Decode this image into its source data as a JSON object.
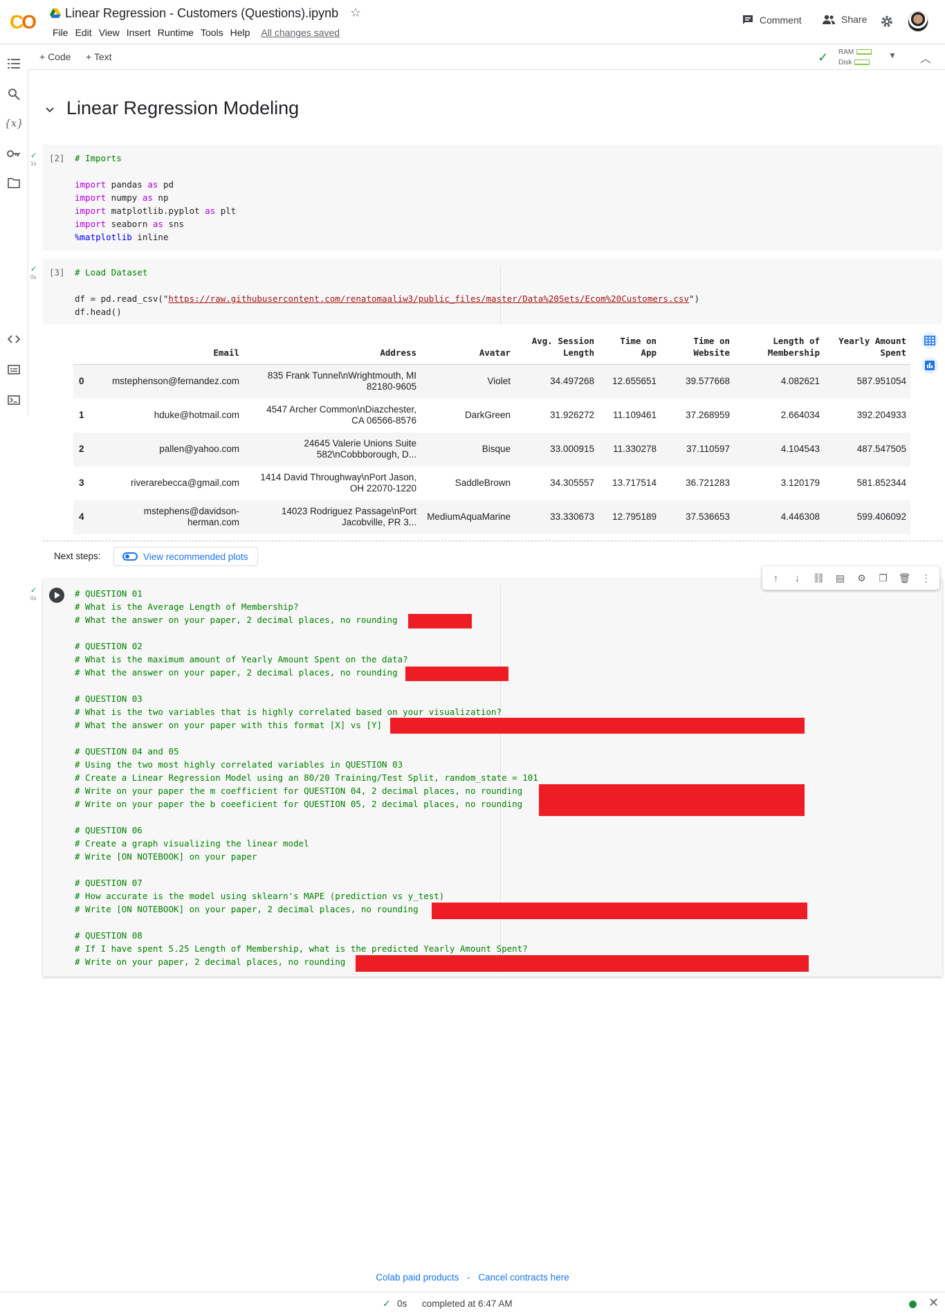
{
  "app": {
    "logo": "CO",
    "title": "Linear Regression - Customers (Questions).ipynb",
    "menu": [
      "File",
      "Edit",
      "View",
      "Insert",
      "Runtime",
      "Tools",
      "Help"
    ],
    "save_status": "All changes saved",
    "comment_label": "Comment",
    "share_label": "Share"
  },
  "toolbar": {
    "add_code": "+ Code",
    "add_text": "+ Text",
    "ram_label": "RAM",
    "disk_label": "Disk"
  },
  "section": {
    "title": "Linear Regression Modeling"
  },
  "cell_imports": {
    "exec_count": "[2]",
    "time": "1s",
    "lines": {
      "comment": "# Imports",
      "l1_kw": "import",
      "l1_rest": " pandas ",
      "l1_as": "as",
      "l1_alias": " pd",
      "l2_kw": "import",
      "l2_rest": " numpy ",
      "l2_as": "as",
      "l2_alias": " np",
      "l3_kw": "import",
      "l3_rest": " matplotlib.pyplot ",
      "l3_as": "as",
      "l3_alias": " plt",
      "l4_kw": "import",
      "l4_rest": " seaborn ",
      "l4_as": "as",
      "l4_alias": " sns",
      "l5_magic": "%matplotlib",
      "l5_rest": " inline"
    }
  },
  "cell_load": {
    "exec_count": "[3]",
    "time": "0s",
    "comment": "# Load Dataset",
    "read_prefix": "df = pd.read_csv(\"",
    "url": "https://raw.githubusercontent.com/renatomaaliw3/public_files/master/Data%20Sets/Ecom%20Customers.csv",
    "read_suffix": "\")",
    "head_call": "df.head()"
  },
  "dataframe": {
    "columns": [
      "Email",
      "Address",
      "Avatar",
      "Avg. Session\nLength",
      "Time on\nApp",
      "Time on\nWebsite",
      "Length of\nMembership",
      "Yearly Amount\nSpent"
    ],
    "rows": [
      {
        "idx": "0",
        "email": "mstephenson@fernandez.com",
        "addr1": "835 Frank Tunnel\\nWrightmouth, MI",
        "addr2": "82180-9605",
        "avatar": "Violet",
        "session": "34.497268",
        "app": "12.655651",
        "website": "39.577668",
        "membership": "4.082621",
        "spent": "587.951054"
      },
      {
        "idx": "1",
        "email": "hduke@hotmail.com",
        "addr1": "4547 Archer Common\\nDiazchester,",
        "addr2": "CA 06566-8576",
        "avatar": "DarkGreen",
        "session": "31.926272",
        "app": "11.109461",
        "website": "37.268959",
        "membership": "2.664034",
        "spent": "392.204933"
      },
      {
        "idx": "2",
        "email": "pallen@yahoo.com",
        "addr1": "24645 Valerie Unions Suite",
        "addr2": "582\\nCobbborough, D...",
        "avatar": "Bisque",
        "session": "33.000915",
        "app": "11.330278",
        "website": "37.110597",
        "membership": "4.104543",
        "spent": "487.547505"
      },
      {
        "idx": "3",
        "email": "riverarebecca@gmail.com",
        "addr1": "1414 David Throughway\\nPort Jason,",
        "addr2": "OH 22070-1220",
        "avatar": "SaddleBrown",
        "session": "34.305557",
        "app": "13.717514",
        "website": "36.721283",
        "membership": "3.120179",
        "spent": "581.852344"
      },
      {
        "idx": "4",
        "email1": "mstephens@davidson-",
        "email2": "herman.com",
        "addr1": "14023 Rodriguez Passage\\nPort",
        "addr2": "Jacobville, PR 3...",
        "avatar": "MediumAquaMarine",
        "session": "33.330673",
        "app": "12.795189",
        "website": "37.536653",
        "membership": "4.446308",
        "spent": "599.406092"
      }
    ]
  },
  "next_steps": {
    "label": "Next steps:",
    "button": "View recommended plots"
  },
  "cell_questions": {
    "time": "0s",
    "lines": [
      "# QUESTION 01",
      "# What is the Average Length of Membership?",
      "# What the answer on your paper, 2 decimal places, no rounding",
      "",
      "# QUESTION 02",
      "# What is the maximum amount of Yearly Amount Spent on the data?",
      "# What the answer on your paper, 2 decimal places, no rounding",
      "",
      "# QUESTION 03",
      "# What is the two variables that is highly correlated based on your visualization?",
      "# What the answer on your paper with this format [X] vs [Y]",
      "",
      "# QUESTION 04 and 05",
      "# Using the two most highly correlated variables in QUESTION 03",
      "# Create a Linear Regression Model using an 80/20 Training/Test Split, random_state = 101",
      "# Write on your paper the m coefficient for QUESTION 04, 2 decimal places, no rounding",
      "# Write on your paper the b coeeficient for QUESTION 05, 2 decimal places, no rounding",
      "",
      "# QUESTION 06",
      "# Create a graph visualizing the linear model",
      "# Write [ON NOTEBOOK] on your paper",
      "",
      "# QUESTION 07",
      "# How accurate is the model using sklearn's MAPE (prediction vs y_test)",
      "# Write [ON NOTEBOOK] on your paper, 2 decimal places, no rounding",
      "",
      "# QUESTION 08",
      "# If I have spent 5.25 Length of Membership, what is the predicted Yearly Amount Spent?",
      "# Write on your paper, 2 decimal places, no rounding"
    ]
  },
  "footer": {
    "paid_products": "Colab paid products",
    "separator": "-",
    "cancel": "Cancel contracts here",
    "status_time": "0s",
    "completed": "completed at 6:47 AM"
  },
  "colors": {
    "redaction": "#ee1c25",
    "comment_green": "#008000",
    "keyword_purple": "#af00db",
    "link_blue": "#1a73e8"
  }
}
